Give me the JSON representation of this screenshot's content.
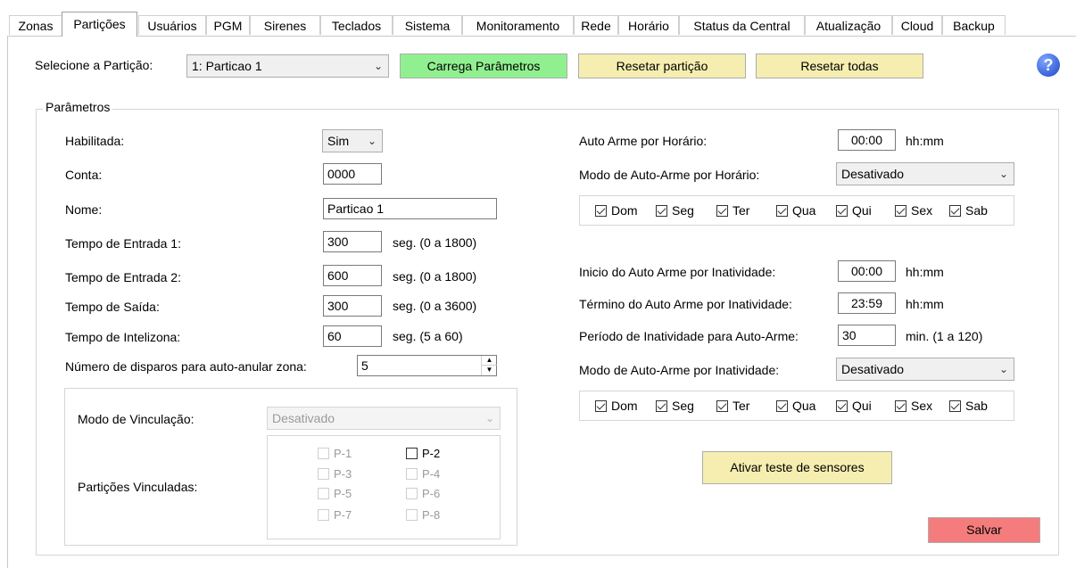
{
  "tabs": [
    {
      "label": "Zonas"
    },
    {
      "label": "Partições"
    },
    {
      "label": "Usuários"
    },
    {
      "label": "PGM"
    },
    {
      "label": "Sirenes"
    },
    {
      "label": "Teclados"
    },
    {
      "label": "Sistema"
    },
    {
      "label": "Monitoramento"
    },
    {
      "label": "Rede"
    },
    {
      "label": "Horário"
    },
    {
      "label": "Status da Central"
    },
    {
      "label": "Atualização"
    },
    {
      "label": "Cloud"
    },
    {
      "label": "Backup"
    }
  ],
  "active_tab": "Partições",
  "toolbar": {
    "select_label": "Selecione a Partição:",
    "partition_value": "1: Particao 1",
    "load_button": "Carrega Parâmetros",
    "reset_button": "Resetar partição",
    "reset_all_button": "Resetar todas",
    "help_icon": "?",
    "load_color": "#90f090",
    "reset_color": "#f5eeb0"
  },
  "params": {
    "title": "Parâmetros",
    "enabled_label": "Habilitada:",
    "enabled_value": "Sim",
    "account_label": "Conta:",
    "account_value": "0000",
    "name_label": "Nome:",
    "name_value": "Particao 1",
    "entry1_label": "Tempo de Entrada 1:",
    "entry1_value": "300",
    "entry1_unit": "seg. (0 a 1800)",
    "entry2_label": "Tempo de Entrada 2:",
    "entry2_value": "600",
    "entry2_unit": "seg. (0 a 1800)",
    "exit_label": "Tempo de Saída:",
    "exit_value": "300",
    "exit_unit": "seg. (0 a 3600)",
    "intelizona_label": "Tempo de Intelizona:",
    "intelizona_value": "60",
    "intelizona_unit": "seg. (5 a 60)",
    "triggers_label": "Número de disparos para auto-anular zona:",
    "triggers_value": "5"
  },
  "link": {
    "mode_label": "Modo de Vinculação:",
    "mode_value": "Desativado",
    "linked_label": "Partições  Vinculadas:",
    "items": [
      {
        "label": "P-1",
        "checked": false,
        "enabled": false
      },
      {
        "label": "P-2",
        "checked": false,
        "enabled": true
      },
      {
        "label": "P-3",
        "checked": false,
        "enabled": false
      },
      {
        "label": "P-4",
        "checked": false,
        "enabled": false
      },
      {
        "label": "P-5",
        "checked": false,
        "enabled": false
      },
      {
        "label": "P-6",
        "checked": false,
        "enabled": false
      },
      {
        "label": "P-7",
        "checked": false,
        "enabled": false
      },
      {
        "label": "P-8",
        "checked": false,
        "enabled": false
      }
    ]
  },
  "auto_arm": {
    "time_label": "Auto Arme por Horário:",
    "time_value": "00:00",
    "time_unit": "hh:mm",
    "mode_label": "Modo de Auto-Arme por Horário:",
    "mode_value": "Desativado",
    "days": [
      {
        "label": "Dom",
        "checked": true
      },
      {
        "label": "Seg",
        "checked": true
      },
      {
        "label": "Ter",
        "checked": true
      },
      {
        "label": "Qua",
        "checked": true
      },
      {
        "label": "Qui",
        "checked": true
      },
      {
        "label": "Sex",
        "checked": true
      },
      {
        "label": "Sab",
        "checked": true
      }
    ]
  },
  "inactivity": {
    "start_label": "Inicio do Auto Arme por Inatividade:",
    "start_value": "00:00",
    "start_unit": "hh:mm",
    "end_label": "Término do Auto Arme por Inatividade:",
    "end_value": "23:59",
    "end_unit": "hh:mm",
    "period_label": "Período de Inatividade para Auto-Arme:",
    "period_value": "30",
    "period_unit": "min. (1 a 120)",
    "mode_label": "Modo de Auto-Arme por Inatividade:",
    "mode_value": "Desativado",
    "days": [
      {
        "label": "Dom",
        "checked": true
      },
      {
        "label": "Seg",
        "checked": true
      },
      {
        "label": "Ter",
        "checked": true
      },
      {
        "label": "Qua",
        "checked": true
      },
      {
        "label": "Qui",
        "checked": true
      },
      {
        "label": "Sex",
        "checked": true
      },
      {
        "label": "Sab",
        "checked": true
      }
    ]
  },
  "actions": {
    "sensor_test_button": "Ativar teste de sensores",
    "save_button": "Salvar",
    "save_color": "#f47c7c"
  }
}
